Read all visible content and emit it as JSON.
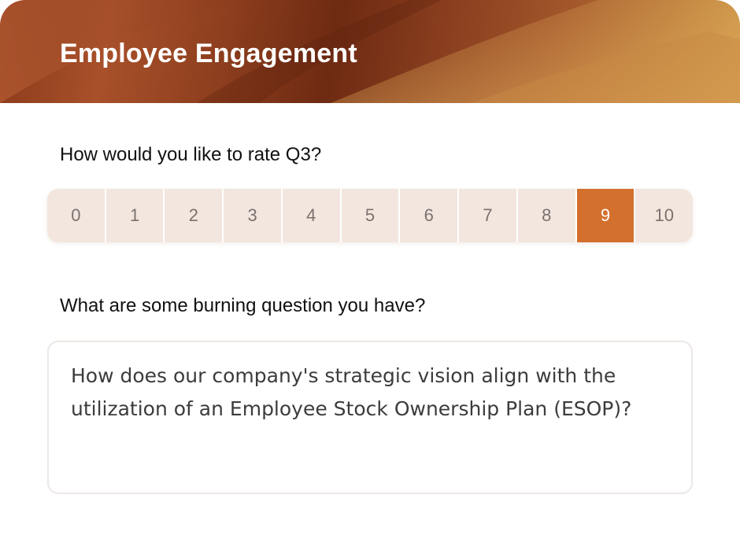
{
  "header": {
    "title": "Employee Engagement"
  },
  "rating": {
    "question": "How would you like to rate Q3?",
    "options": [
      "0",
      "1",
      "2",
      "3",
      "4",
      "5",
      "6",
      "7",
      "8",
      "9",
      "10"
    ],
    "selected": "9"
  },
  "burning_question": {
    "label": "What are some burning question you have?",
    "value": "How does our company's strategic vision align with the utilization of an Employee Stock Ownership Plan (ESOP)?"
  },
  "colors": {
    "accent": "#d4702d",
    "option_bg": "#f2e6de",
    "header_dark": "#6e2a12",
    "header_light": "#c89446"
  }
}
